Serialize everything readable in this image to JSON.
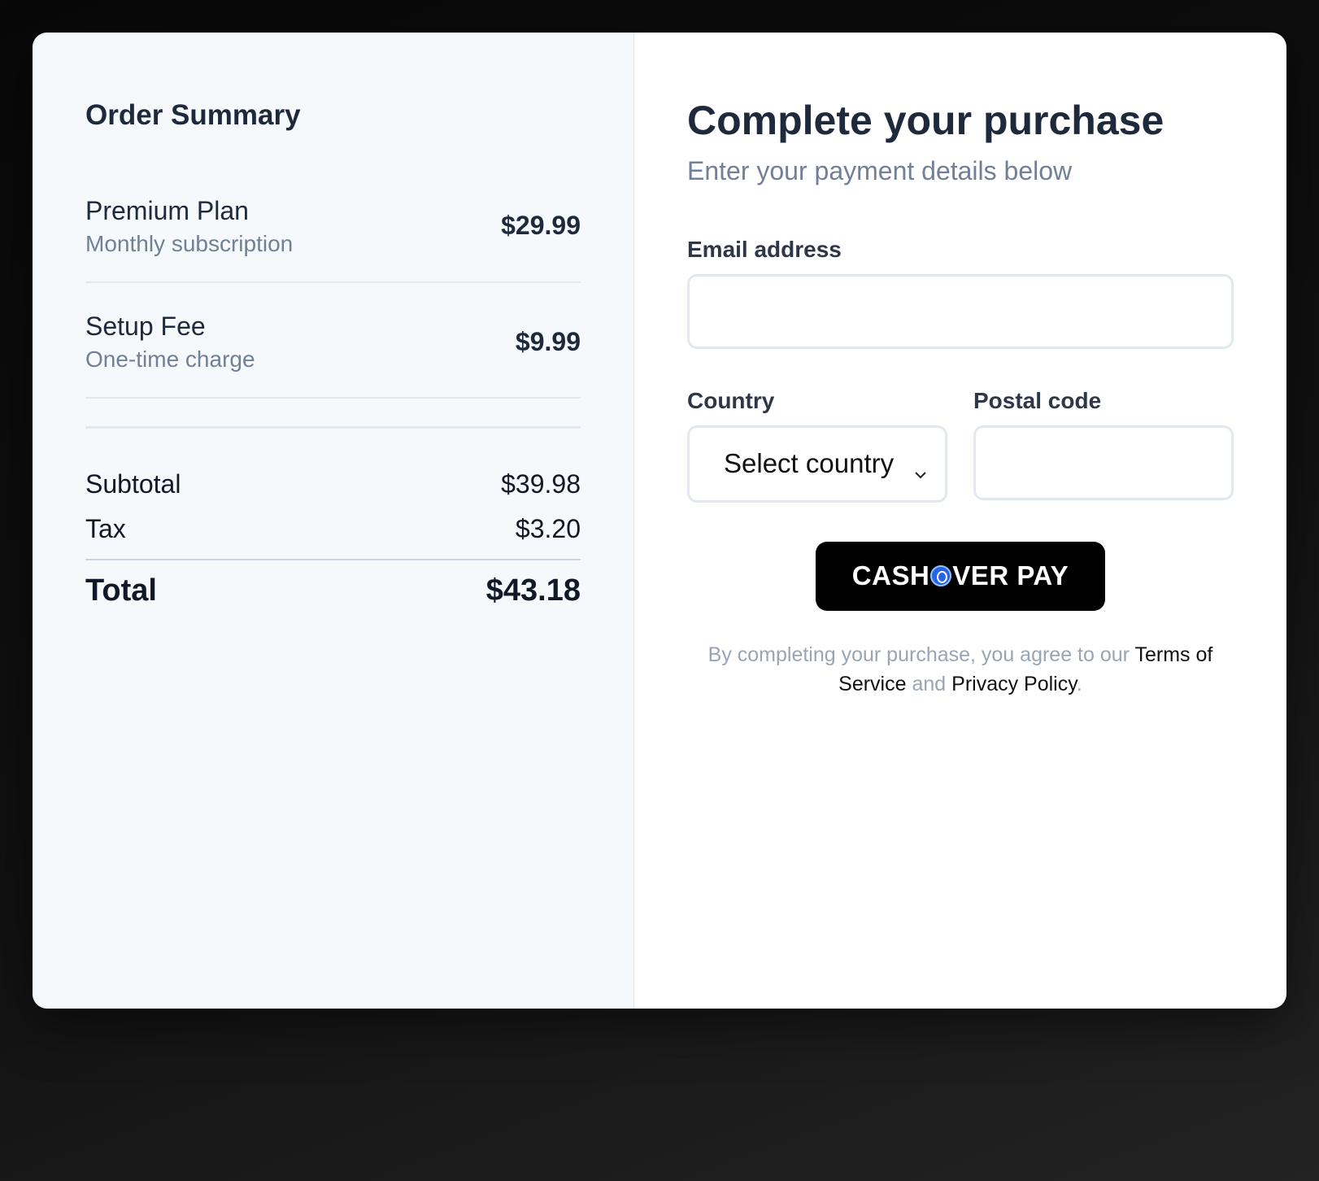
{
  "order_summary": {
    "title": "Order Summary",
    "items": [
      {
        "name": "Premium Plan",
        "description": "Monthly subscription",
        "price": "$29.99"
      },
      {
        "name": "Setup Fee",
        "description": "One-time charge",
        "price": "$9.99"
      }
    ],
    "subtotal_label": "Subtotal",
    "subtotal_value": "$39.98",
    "tax_label": "Tax",
    "tax_value": "$3.20",
    "total_label": "Total",
    "total_value": "$43.18"
  },
  "checkout": {
    "heading": "Complete your purchase",
    "subheading": "Enter your payment details below",
    "email_label": "Email address",
    "email_value": "",
    "country_label": "Country",
    "country_selected": "Select country",
    "postal_label": "Postal code",
    "postal_value": "",
    "pay_button": {
      "text_before": "CASH",
      "text_after": "VER PAY",
      "mark_icon": "circle-o-logo-icon",
      "mark_color": "#2563eb"
    },
    "legal": {
      "prefix": "By completing your purchase, you agree to our",
      "terms": "Terms of Service",
      "and": "and",
      "privacy": "Privacy Policy",
      "suffix": "."
    }
  }
}
